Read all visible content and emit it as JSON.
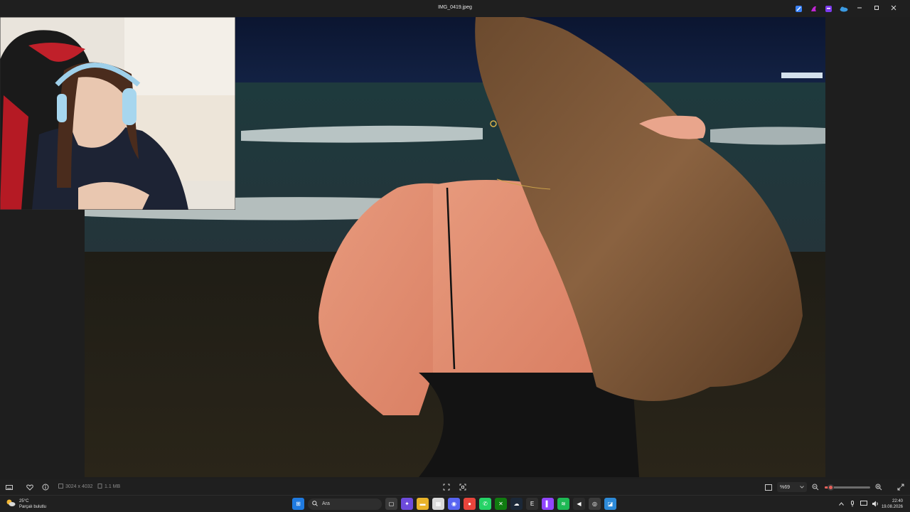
{
  "window": {
    "title": "IMG_0419.jpeg"
  },
  "titlebar_apps": [
    {
      "icon": "app-icon-blue",
      "color": "#3b82f6"
    },
    {
      "icon": "app-icon-copilot",
      "color": "#c026d3"
    },
    {
      "icon": "app-icon-purple",
      "color": "#7c3aed"
    },
    {
      "icon": "onedrive-icon",
      "color": "#3b9ae1"
    }
  ],
  "photo_info": {
    "dimensions": "3024 x 4032",
    "size": "1.1 MB"
  },
  "zoom": {
    "label": "%69",
    "value": 0.69
  },
  "weather": {
    "temp": "25°C",
    "desc": "Parçalı bulutlu"
  },
  "search": {
    "label": "Ara"
  },
  "taskbar_apps": [
    {
      "name": "start-button",
      "color": "#1f7ae0",
      "glyph": "⊞"
    },
    {
      "name": "task-view",
      "color": "#3a3a3a",
      "glyph": "▢"
    },
    {
      "name": "copilot",
      "color": "#6d4bdc",
      "glyph": "✦"
    },
    {
      "name": "file-explorer",
      "color": "#e8b32a",
      "glyph": "▬"
    },
    {
      "name": "calendar",
      "color": "#d9d9d9",
      "glyph": "▦"
    },
    {
      "name": "discord",
      "color": "#5865f2",
      "glyph": "◉"
    },
    {
      "name": "chrome",
      "color": "#e8453c",
      "glyph": "●"
    },
    {
      "name": "whatsapp",
      "color": "#25d366",
      "glyph": "✆"
    },
    {
      "name": "xbox",
      "color": "#107c10",
      "glyph": "✕"
    },
    {
      "name": "steam",
      "color": "#1b2838",
      "glyph": "☁"
    },
    {
      "name": "epic-games",
      "color": "#2f2f2f",
      "glyph": "E"
    },
    {
      "name": "twitch",
      "color": "#9146ff",
      "glyph": "▌"
    },
    {
      "name": "spotify",
      "color": "#1db954",
      "glyph": "≋"
    },
    {
      "name": "capcut",
      "color": "#2b2b2b",
      "glyph": "◀"
    },
    {
      "name": "obs",
      "color": "#3b3b3b",
      "glyph": "◎"
    },
    {
      "name": "photos",
      "color": "#2d8ad8",
      "glyph": "◪"
    }
  ],
  "clock": {
    "time": "22:40",
    "date": "19.08.2026"
  }
}
